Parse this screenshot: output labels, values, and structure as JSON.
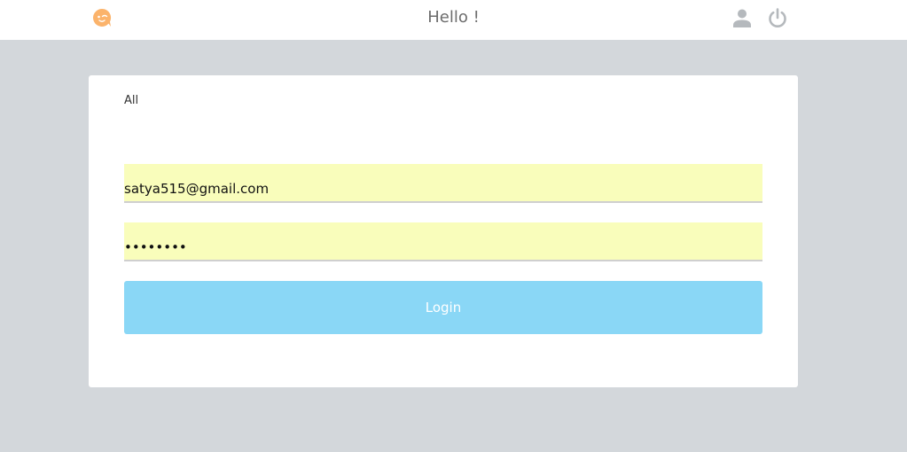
{
  "header": {
    "title": "Hello !",
    "logo_icon": "chat-face-icon",
    "logo_color": "#fbb36b",
    "user_icon": "user-icon",
    "power_icon": "power-icon",
    "icon_color": "#b5b9bd"
  },
  "card": {
    "filter_label": "All",
    "email": {
      "value": "satya515@gmail.com"
    },
    "password": {
      "value": "********"
    },
    "login_label": "Login",
    "login_color": "#8ad7f6",
    "field_color": "#f9fdbb"
  }
}
